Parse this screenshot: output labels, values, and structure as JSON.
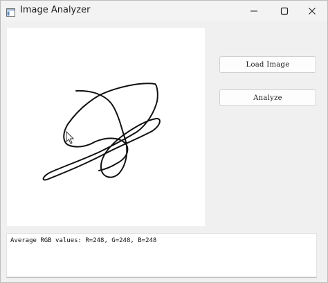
{
  "window": {
    "title": "Image Analyzer",
    "icon": "app-window-icon",
    "controls": [
      "minimize-icon",
      "maximize-icon",
      "close-icon"
    ]
  },
  "buttons": {
    "load_label": "Load Image",
    "analyze_label": "Analyze"
  },
  "output": {
    "text": "Average RGB values: R=248, G=248, B=248"
  },
  "canvas": {
    "content": "scribble-drawing",
    "cursor": "mouse-pointer-icon"
  }
}
